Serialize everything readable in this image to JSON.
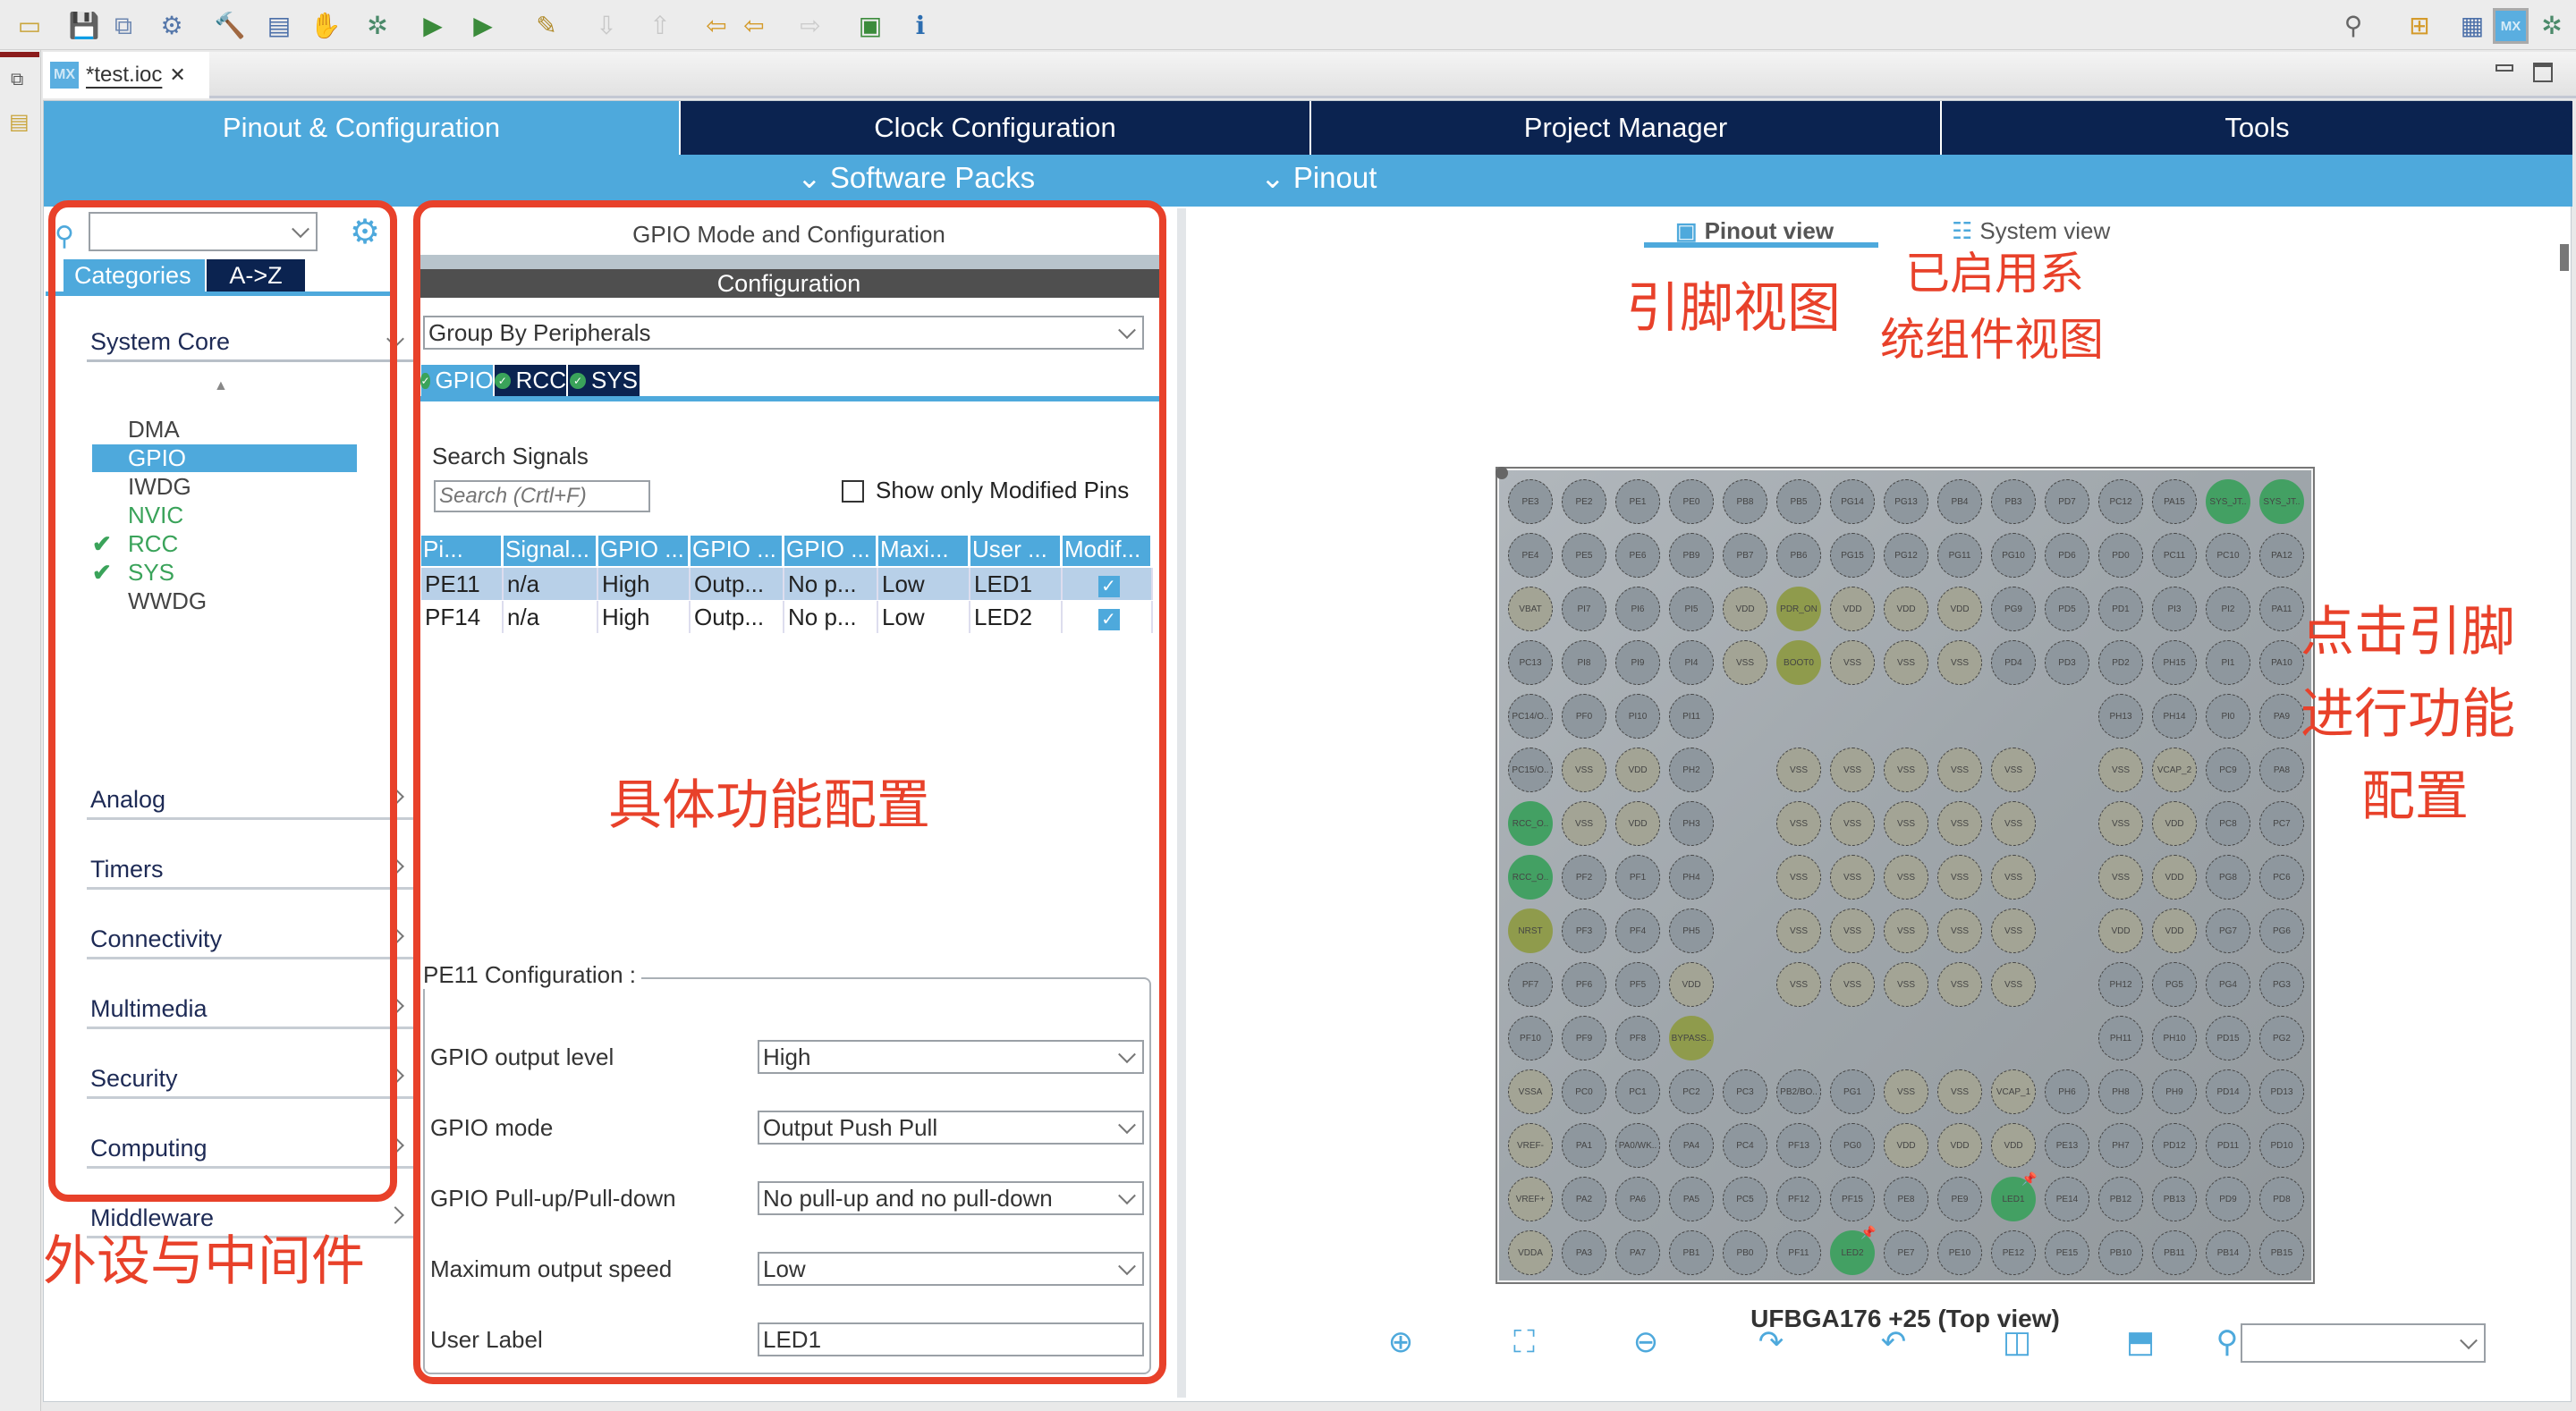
{
  "toolbar": {
    "icons": [
      {
        "name": "new-file-icon",
        "glyph": "▭",
        "color": "#c9a53c"
      },
      {
        "name": "save-icon",
        "glyph": "💾",
        "color": "#6c86b0"
      },
      {
        "name": "save-all-icon",
        "glyph": "⧉",
        "color": "#6c86b0"
      },
      {
        "name": "build-config-icon",
        "glyph": "⚙",
        "color": "#5577aa"
      },
      {
        "name": "build-hammer-icon",
        "glyph": "🔨",
        "color": "#7a5a3a"
      },
      {
        "name": "binary-file-icon",
        "glyph": "▤",
        "color": "#4b6fa8"
      },
      {
        "name": "generate-code-icon",
        "glyph": "✋",
        "color": "#d6a520"
      },
      {
        "name": "debug-icon",
        "glyph": "✲",
        "color": "#4b8a6a"
      },
      {
        "name": "run-icon",
        "glyph": "▶",
        "color": "#3b8b3b"
      },
      {
        "name": "run-external-tool-icon",
        "glyph": "▶",
        "color": "#3b8b3b"
      },
      {
        "name": "pen-icon",
        "glyph": "✎",
        "color": "#b08a2a"
      },
      {
        "name": "next-annotation-icon",
        "glyph": "⇩",
        "color": "#c8c8c8"
      },
      {
        "name": "previous-annotation-icon",
        "glyph": "⇧",
        "color": "#c8c8c8"
      },
      {
        "name": "last-edit-location-icon",
        "glyph": "⇦",
        "color": "#d49a2a"
      },
      {
        "name": "back-icon",
        "glyph": "⇦",
        "color": "#d49a2a"
      },
      {
        "name": "forward-icon",
        "glyph": "⇨",
        "color": "#cccccc"
      },
      {
        "name": "open-perspective-icon",
        "glyph": "▣",
        "color": "#3b8b3b"
      },
      {
        "name": "info-icon",
        "glyph": "ℹ",
        "color": "#2c6db0"
      }
    ],
    "right_icons": [
      {
        "name": "search-icon",
        "glyph": "⚲",
        "color": "#666"
      },
      {
        "name": "open-perspective-icon",
        "glyph": "⊞",
        "color": "#d49a2a"
      },
      {
        "name": "c-perspective-icon",
        "glyph": "▦",
        "color": "#4b6fa8"
      },
      {
        "name": "mx-perspective-icon",
        "glyph": "MX",
        "color": "#5aaee0"
      },
      {
        "name": "debug-perspective-icon",
        "glyph": "✲",
        "color": "#4b8a6a"
      }
    ]
  },
  "editor": {
    "file_tab": "*test.ioc",
    "mx_badge": "MX"
  },
  "main_tabs": [
    "Pinout & Configuration",
    "Clock Configuration",
    "Project Manager",
    "Tools"
  ],
  "sub_menu": {
    "software_packs": "Software Packs",
    "pinout": "Pinout"
  },
  "left_panel": {
    "search_value": "",
    "tabs": [
      "Categories",
      "A->Z"
    ],
    "system_core": "System Core",
    "system_core_items": [
      {
        "label": "DMA",
        "state": "normal"
      },
      {
        "label": "GPIO",
        "state": "selected"
      },
      {
        "label": "IWDG",
        "state": "normal"
      },
      {
        "label": "NVIC",
        "state": "green"
      },
      {
        "label": "RCC",
        "state": "checked"
      },
      {
        "label": "SYS",
        "state": "checked"
      },
      {
        "label": "WWDG",
        "state": "normal"
      }
    ],
    "categories": [
      "Analog",
      "Timers",
      "Connectivity",
      "Multimedia",
      "Security",
      "Computing",
      "Middleware"
    ]
  },
  "middle_panel": {
    "title": "GPIO Mode and Configuration",
    "config_header": "Configuration",
    "group_by": "Group By Peripherals",
    "tabs": [
      "GPIO",
      "RCC",
      "SYS"
    ],
    "search_label": "Search Signals",
    "search_placeholder": "Search (Crtl+F)",
    "show_modified_label": "Show only Modified Pins",
    "show_modified_checked": false,
    "table": {
      "headers": [
        "Pi...",
        "Signal...",
        "GPIO ...",
        "GPIO ...",
        "GPIO ...",
        "Maxi...",
        "User ...",
        "Modif..."
      ],
      "rows": [
        [
          "PE11",
          "n/a",
          "High",
          "Outp...",
          "No p...",
          "Low",
          "LED1",
          true
        ],
        [
          "PF14",
          "n/a",
          "High",
          "Outp...",
          "No p...",
          "Low",
          "LED2",
          true
        ]
      ]
    },
    "pin_config": {
      "title": "PE11 Configuration :",
      "fields": [
        {
          "label": "GPIO output level",
          "value": "High",
          "type": "select"
        },
        {
          "label": "GPIO mode",
          "value": "Output Push Pull",
          "type": "select"
        },
        {
          "label": "GPIO Pull-up/Pull-down",
          "value": "No pull-up and no pull-down",
          "type": "select"
        },
        {
          "label": "Maximum output speed",
          "value": "Low",
          "type": "select"
        },
        {
          "label": "User Label",
          "value": "LED1",
          "type": "text"
        }
      ]
    }
  },
  "right_panel": {
    "view_tabs": [
      "Pinout view",
      "System view"
    ],
    "active_view": "Pinout view",
    "package_label": "UFBGA176 +25 (Top view)",
    "zoom_select_value": "",
    "bottom_icons": [
      "zoom-in-icon",
      "fit-to-window-icon",
      "zoom-out-icon",
      "rotate-right-icon",
      "rotate-left-icon",
      "flip-vertical-icon",
      "flip-horizontal-icon",
      "search-pin-icon"
    ],
    "pin_colors": {
      "gpio": "#8e979e",
      "power": "#a3a495",
      "special": "#8f9b4c",
      "assigned": "#43a063"
    },
    "special_pins": [
      "PDR_ON",
      "BOOT0",
      "NRST",
      "BYPASS.."
    ],
    "assigned_pins": [
      "SYS_JT..",
      "RCC_O..",
      "LED1",
      "LED2"
    ],
    "pinned_pins": [
      "LED1",
      "LED2"
    ],
    "pins": [
      [
        "PE3",
        "PE2",
        "PE1",
        "PE0",
        "PB8",
        "PB5",
        "PG14",
        "PG13",
        "PB4",
        "PB3",
        "PD7",
        "PC12",
        "PA15",
        "SYS_JT..",
        "SYS_JT.."
      ],
      [
        "PE4",
        "PE5",
        "PE6",
        "PB9",
        "PB7",
        "PB6",
        "PG15",
        "PG12",
        "PG11",
        "PG10",
        "PD6",
        "PD0",
        "PC11",
        "PC10",
        "PA12"
      ],
      [
        "VBAT",
        "PI7",
        "PI6",
        "PI5",
        "VDD",
        "PDR_ON",
        "VDD",
        "VDD",
        "VDD",
        "PG9",
        "PD5",
        "PD1",
        "PI3",
        "PI2",
        "PA11"
      ],
      [
        "PC13",
        "PI8",
        "PI9",
        "PI4",
        "VSS",
        "BOOT0",
        "VSS",
        "VSS",
        "VSS",
        "PD4",
        "PD3",
        "PD2",
        "PH15",
        "PI1",
        "PA10"
      ],
      [
        "PC14/O..",
        "PF0",
        "PI10",
        "PI11",
        "",
        "",
        "",
        "",
        "",
        "",
        "",
        "PH13",
        "PH14",
        "PI0",
        "PA9"
      ],
      [
        "PC15/O..",
        "VSS",
        "VDD",
        "PH2",
        "",
        "VSS",
        "VSS",
        "VSS",
        "VSS",
        "VSS",
        "",
        "VSS",
        "VCAP_2",
        "PC9",
        "PA8"
      ],
      [
        "RCC_O..",
        "VSS",
        "VDD",
        "PH3",
        "",
        "VSS",
        "VSS",
        "VSS",
        "VSS",
        "VSS",
        "",
        "VSS",
        "VDD",
        "PC8",
        "PC7"
      ],
      [
        "RCC_O..",
        "PF2",
        "PF1",
        "PH4",
        "",
        "VSS",
        "VSS",
        "VSS",
        "VSS",
        "VSS",
        "",
        "VSS",
        "VDD",
        "PG8",
        "PC6"
      ],
      [
        "NRST",
        "PF3",
        "PF4",
        "PH5",
        "",
        "VSS",
        "VSS",
        "VSS",
        "VSS",
        "VSS",
        "",
        "VDD",
        "VDD",
        "PG7",
        "PG6"
      ],
      [
        "PF7",
        "PF6",
        "PF5",
        "VDD",
        "",
        "VSS",
        "VSS",
        "VSS",
        "VSS",
        "VSS",
        "",
        "PH12",
        "PG5",
        "PG4",
        "PG3"
      ],
      [
        "PF10",
        "PF9",
        "PF8",
        "BYPASS..",
        "",
        "",
        "",
        "",
        "",
        "",
        "",
        "PH11",
        "PH10",
        "PD15",
        "PG2"
      ],
      [
        "VSSA",
        "PC0",
        "PC1",
        "PC2",
        "PC3",
        "PB2/BO..",
        "PG1",
        "VSS",
        "VSS",
        "VCAP_1",
        "PH6",
        "PH8",
        "PH9",
        "PD14",
        "PD13"
      ],
      [
        "VREF-",
        "PA1",
        "PA0/WK..",
        "PA4",
        "PC4",
        "PF13",
        "PG0",
        "VDD",
        "VDD",
        "VDD",
        "PE13",
        "PH7",
        "PD12",
        "PD11",
        "PD10"
      ],
      [
        "VREF+",
        "PA2",
        "PA6",
        "PA5",
        "PC5",
        "PF12",
        "PF15",
        "PE8",
        "PE9",
        "LED1",
        "PE14",
        "PB12",
        "PB13",
        "PD9",
        "PD8"
      ],
      [
        "VDDA",
        "PA3",
        "PA7",
        "PB1",
        "PB0",
        "PF11",
        "LED2",
        "PE7",
        "PE10",
        "PE12",
        "PE15",
        "PB10",
        "PB11",
        "PB14",
        "PB15"
      ]
    ]
  },
  "annotations": {
    "peripherals": "外设与中间件",
    "function_config": "具体功能配置",
    "pinout_view": "引脚视图",
    "system_view_line1": "已启用系",
    "system_view_line2": "统组件视图",
    "click_pin_line1": "点击引脚",
    "click_pin_line2": "进行功能",
    "click_pin_line3": "配置",
    "color": "#e8412a"
  },
  "colors": {
    "accent": "#4ea9dc",
    "dark_tab": "#0b2350"
  }
}
